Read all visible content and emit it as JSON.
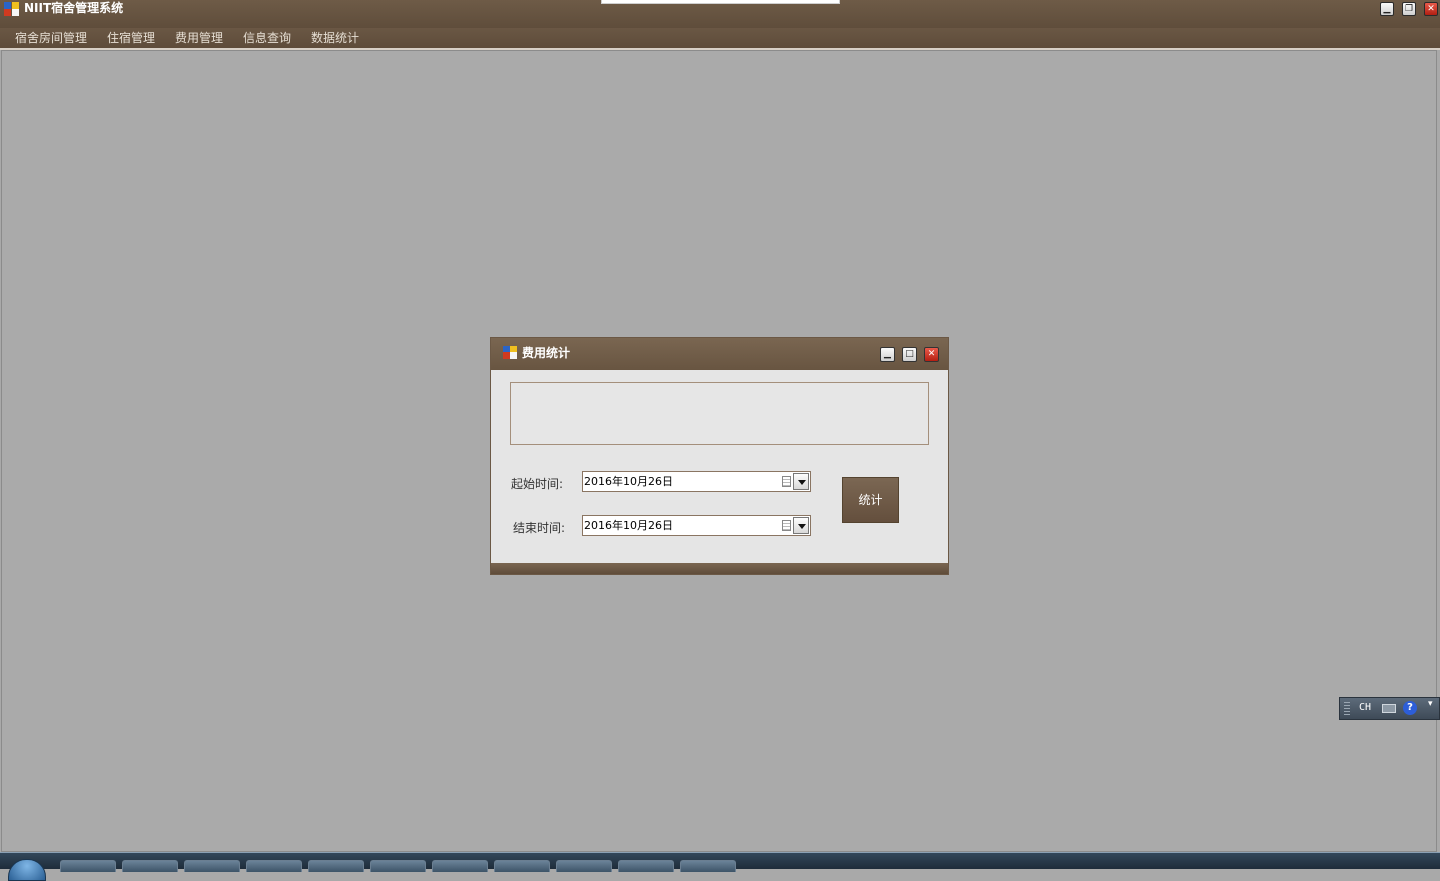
{
  "app": {
    "title": "NIIT宿舍管理系统",
    "window_buttons": {
      "minimize": "▁",
      "restore": "❐",
      "close": "✕"
    }
  },
  "menu": {
    "items": [
      {
        "label": "宿舍房间管理"
      },
      {
        "label": "住宿管理"
      },
      {
        "label": "费用管理"
      },
      {
        "label": "信息查询"
      },
      {
        "label": "数据统计"
      }
    ]
  },
  "dialog": {
    "title": "费用统计",
    "buttons": {
      "minimize": "▁",
      "maximize": "□",
      "close": "✕"
    },
    "start_label": "起始时间:",
    "start_value": "2016年10月26日",
    "end_label": "结束时间:",
    "end_value": "2016年10月26日",
    "stat_button": "统计"
  },
  "ime": {
    "lang": "CH",
    "help": "?",
    "more": "▾"
  },
  "colors": {
    "chrome": "#685541",
    "workspace": "#aaaaaa",
    "dialog_body": "#e5e5e5",
    "accent_button": "#6e5a46",
    "close_red": "#c62b1c"
  }
}
